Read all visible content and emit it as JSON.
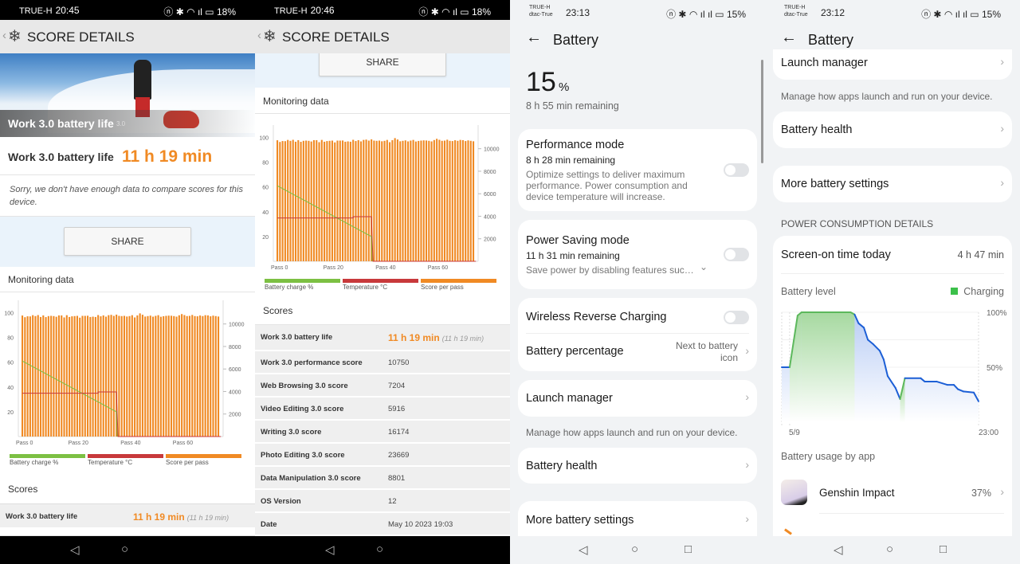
{
  "screens": [
    {
      "status": {
        "carrier": "TRUE-H",
        "time": "20:45",
        "battery": "18%"
      },
      "header": {
        "title": "SCORE DETAILS"
      },
      "hero": {
        "title": "Work 3.0 battery life",
        "version": "3.0"
      },
      "result": {
        "label": "Work 3.0 battery life",
        "value": "11 h 19 min"
      },
      "note": "Sorry, we don't have enough data to compare scores for this device.",
      "share_label": "SHARE",
      "monitoring_title": "Monitoring data",
      "scores_title": "Scores",
      "scores": [
        {
          "label": "Work 3.0 battery life",
          "value": "11 h 19 min",
          "sub": "(11 h 19 min)"
        }
      ]
    },
    {
      "status": {
        "carrier": "TRUE-H",
        "time": "20:46",
        "battery": "18%"
      },
      "header": {
        "title": "SCORE DETAILS"
      },
      "share_label": "SHARE",
      "monitoring_title": "Monitoring data",
      "scores_title": "Scores",
      "scores": [
        {
          "label": "Work 3.0 battery life",
          "value": "11 h 19 min",
          "sub": "(11 h 19 min)"
        },
        {
          "label": "Work 3.0 performance score",
          "value": "10750"
        },
        {
          "label": "Web Browsing 3.0 score",
          "value": "7204"
        },
        {
          "label": "Video Editing 3.0 score",
          "value": "5916"
        },
        {
          "label": "Writing 3.0 score",
          "value": "16174"
        },
        {
          "label": "Photo Editing 3.0 score",
          "value": "23669"
        },
        {
          "label": "Data Manipulation 3.0 score",
          "value": "8801"
        },
        {
          "label": "OS Version",
          "value": "12"
        },
        {
          "label": "Date",
          "value": "May 10 2023 19:03"
        }
      ]
    },
    {
      "status": {
        "carrier1": "TRUE-H",
        "carrier2": "dtac-True",
        "time": "23:13",
        "battery": "15%"
      },
      "header": {
        "title": "Battery"
      },
      "level": {
        "value": "15",
        "unit": "%",
        "remaining": "8 h 55 min remaining"
      },
      "performance": {
        "title": "Performance mode",
        "remaining": "8 h 28 min remaining",
        "desc": "Optimize settings to deliver maximum performance. Power consumption and device temperature will increase.",
        "enabled": false
      },
      "power_saving": {
        "title": "Power Saving mode",
        "remaining": "11 h 31 min remaining",
        "desc": "Save power by disabling features suc…",
        "enabled": false
      },
      "wireless_reverse": {
        "title": "Wireless Reverse Charging",
        "enabled": false
      },
      "battery_percentage": {
        "title": "Battery percentage",
        "value": "Next to battery icon"
      },
      "launch_manager": {
        "title": "Launch manager",
        "caption": "Manage how apps launch and run on your device."
      },
      "battery_health": {
        "title": "Battery health"
      },
      "more_settings": {
        "title": "More battery settings"
      }
    },
    {
      "status": {
        "carrier1": "TRUE-H",
        "carrier2": "dtac-True",
        "time": "23:12",
        "battery": "15%"
      },
      "header": {
        "title": "Battery"
      },
      "launch_manager": {
        "title": "Launch manager",
        "caption": "Manage how apps launch and run on your device."
      },
      "battery_health": {
        "title": "Battery health"
      },
      "more_settings": {
        "title": "More battery settings"
      },
      "section_title": "POWER CONSUMPTION DETAILS",
      "screen_on": {
        "label": "Screen-on time today",
        "value": "4 h 47 min"
      },
      "battery_level_label": "Battery level",
      "usage_title": "Battery usage by app",
      "apps": [
        {
          "name": "Genshin Impact",
          "percent": "37%"
        }
      ]
    }
  ],
  "colors": {
    "accent_orange": "#f08a24",
    "battery_green": "#7cc043",
    "temperature_red": "#c8393b",
    "charging_green": "#3cc04a",
    "level_blue": "#1c5fd6"
  },
  "chart_data": [
    {
      "type": "bar",
      "title": "Monitoring data",
      "x_ticks": [
        "Pass 0",
        "Pass 20",
        "Pass 40",
        "Pass 60"
      ],
      "x_tick_values": [
        0,
        20,
        40,
        60
      ],
      "y_left_ticks": [
        20,
        40,
        60,
        80,
        100
      ],
      "y_right_ticks": [
        2000,
        4000,
        6000,
        8000,
        10000
      ],
      "ylim_left": [
        0,
        110
      ],
      "ylim_right": [
        0,
        12100
      ],
      "series": [
        {
          "name": "Battery charge %",
          "type": "line",
          "color": "#7cc043",
          "points": [
            [
              0,
              61
            ],
            [
              36,
              20
            ],
            [
              36.3,
              0
            ]
          ]
        },
        {
          "name": "Temperature °C",
          "type": "line",
          "color": "#c8393b",
          "points": [
            [
              0,
              35
            ],
            [
              29,
              35
            ],
            [
              29,
              36
            ],
            [
              36,
              36
            ],
            [
              36.6,
              0
            ],
            [
              76,
              0
            ]
          ]
        },
        {
          "name": "Score per pass",
          "type": "bar",
          "color": "#f08a24",
          "axis": "right",
          "values": [
            10750,
            10600,
            10680,
            10670,
            10780,
            10700,
            10790,
            10620,
            10760,
            10610,
            10700,
            10720,
            10700,
            10640,
            10760,
            10760,
            10580,
            10780,
            10620,
            10680,
            10700,
            10720,
            10560,
            10720,
            10720,
            10730,
            10620,
            10650,
            10620,
            10790,
            10680,
            10760,
            10650,
            10780,
            10810,
            10720,
            10830,
            10720,
            10700,
            10720,
            10660,
            10700,
            10780,
            10580,
            10760,
            10940,
            10820,
            10660,
            10700,
            10740,
            10650,
            10720,
            10780,
            10640,
            10690,
            10720,
            10740,
            10730,
            10700,
            10650,
            10770,
            10880,
            10790,
            10700,
            10720,
            10800,
            10700,
            10680,
            10750,
            10700,
            10780,
            10760,
            10680,
            10740,
            10700,
            10660
          ]
        }
      ],
      "legend": [
        "Battery charge %",
        "Temperature °C",
        "Score per pass"
      ],
      "legend_position": "bottom",
      "grid": false
    },
    {
      "type": "area",
      "title": "Battery level",
      "x_ticks": [
        "5/9",
        "23:00"
      ],
      "y_ticks": [
        "100%",
        "50%"
      ],
      "ylim": [
        0,
        100
      ],
      "legend": [
        "Charging"
      ],
      "legend_position": "top-right",
      "grid": true,
      "points": [
        {
          "t": "23:00",
          "v": 50,
          "charging": false
        },
        {
          "t": "23:58",
          "v": 50,
          "charging": true
        },
        {
          "t": "00:56",
          "v": 97,
          "charging": true
        },
        {
          "t": "01:25",
          "v": 100,
          "charging": true
        },
        {
          "t": "07:24",
          "v": 100,
          "charging": true
        },
        {
          "t": "07:53",
          "v": 98,
          "charging": false
        },
        {
          "t": "08:22",
          "v": 90,
          "charging": false
        },
        {
          "t": "09:01",
          "v": 86,
          "charging": false
        },
        {
          "t": "09:30",
          "v": 75,
          "charging": false
        },
        {
          "t": "10:09",
          "v": 71,
          "charging": false
        },
        {
          "t": "10:57",
          "v": 65,
          "charging": false
        },
        {
          "t": "11:26",
          "v": 57,
          "charging": false
        },
        {
          "t": "11:55",
          "v": 42,
          "charging": false
        },
        {
          "t": "12:53",
          "v": 31,
          "charging": false
        },
        {
          "t": "13:26",
          "v": 21,
          "charging": true
        },
        {
          "t": "14:01",
          "v": 40,
          "charging": false
        },
        {
          "t": "15:57",
          "v": 40,
          "charging": false
        },
        {
          "t": "16:26",
          "v": 37,
          "charging": false
        },
        {
          "t": "17:53",
          "v": 37,
          "charging": false
        },
        {
          "t": "19:11",
          "v": 34,
          "charging": false
        },
        {
          "t": "19:59",
          "v": 34,
          "charging": false
        },
        {
          "t": "20:29",
          "v": 30,
          "charging": false
        },
        {
          "t": "21:08",
          "v": 28,
          "charging": false
        },
        {
          "t": "22:25",
          "v": 27,
          "charging": false
        },
        {
          "t": "23:00",
          "v": 19,
          "charging": false
        }
      ]
    }
  ]
}
